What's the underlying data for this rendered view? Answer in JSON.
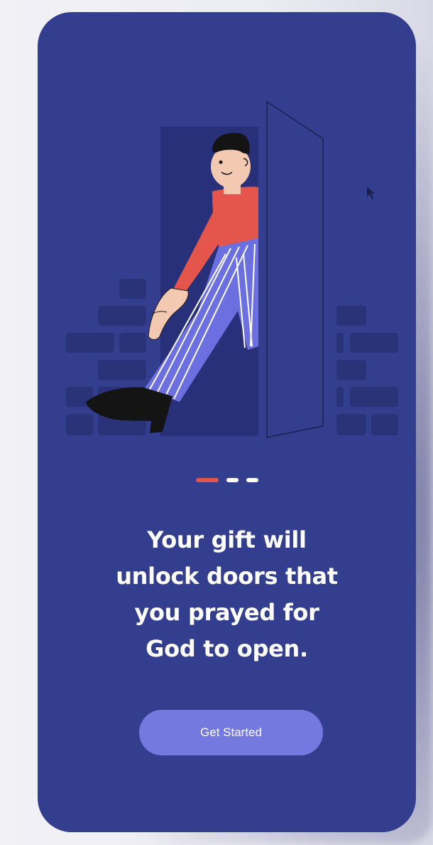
{
  "onboarding": {
    "headline_lines": [
      "Your gift will",
      "unlock doors that",
      "you prayed for",
      "God to open."
    ],
    "cta_label": "Get Started",
    "pagination": {
      "total": 3,
      "active": 1
    }
  },
  "colors": {
    "card_background": "#333f8e",
    "accent_active_dot": "#e0564a",
    "cta_background": "#7479e0",
    "text": "#ffffff"
  },
  "illustration": {
    "subject": "person-stepping-through-door-icon"
  }
}
